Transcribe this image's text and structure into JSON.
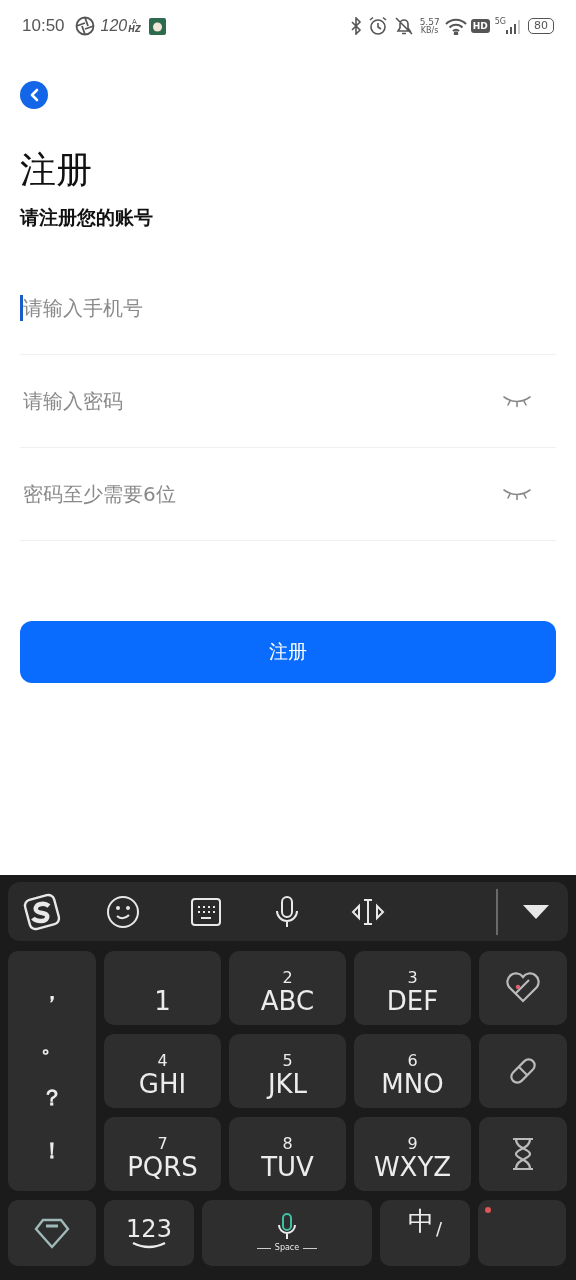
{
  "status_bar": {
    "time": "10:50",
    "refresh_rate": "120",
    "refresh_unit": "HZ",
    "refresh_mode": "A",
    "speed": "5.57",
    "speed_unit": "KB/s",
    "hd": "HD",
    "network": "5G",
    "battery": "80"
  },
  "title": "注册",
  "subtitle": "请注册您的账号",
  "fields": [
    {
      "kind": "text",
      "placeholder": "请输入手机号",
      "focused": true
    },
    {
      "kind": "password",
      "placeholder": "请输入密码",
      "focused": false
    },
    {
      "kind": "password",
      "placeholder": "密码至少需要6位",
      "focused": false
    }
  ],
  "submit": "注册",
  "keyboard": {
    "punctuation": [
      "，",
      "。",
      "？",
      "！"
    ],
    "key_rows": [
      [
        {
          "letters": "1"
        },
        {
          "number": "2",
          "letters": "ABC"
        },
        {
          "number": "3",
          "letters": "DEF"
        }
      ],
      [
        {
          "number": "4",
          "letters": "GHI"
        },
        {
          "number": "5",
          "letters": "JKL"
        },
        {
          "number": "6",
          "letters": "MNO"
        }
      ],
      [
        {
          "number": "7",
          "letters": "PQRS"
        },
        {
          "number": "8",
          "letters": "TUV"
        },
        {
          "number": "9",
          "letters": "WXYZ"
        }
      ]
    ],
    "numbers_key": "123",
    "space_label": "Space",
    "lang_key": "中",
    "lang_separator": "/"
  }
}
